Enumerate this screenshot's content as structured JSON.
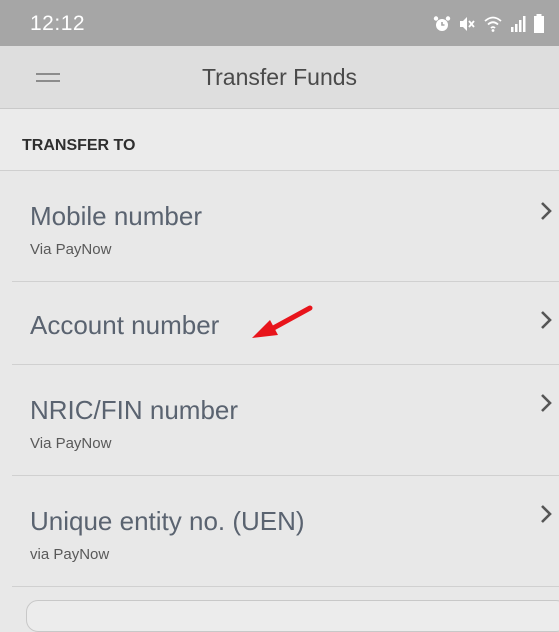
{
  "status_bar": {
    "time": "12:12",
    "icons": [
      "alarm-icon",
      "mute-icon",
      "wifi-icon",
      "signal-icon",
      "battery-icon"
    ]
  },
  "header": {
    "title": "Transfer Funds",
    "menu_icon": "hamburger-menu-icon"
  },
  "section": {
    "label": "TRANSFER TO"
  },
  "transfer_options": [
    {
      "title": "Mobile number",
      "subtitle": "Via PayNow"
    },
    {
      "title": "Account number",
      "subtitle": ""
    },
    {
      "title": "NRIC/FIN number",
      "subtitle": "Via PayNow"
    },
    {
      "title": "Unique entity no. (UEN)",
      "subtitle": "via PayNow"
    }
  ],
  "annotation": {
    "arrow_color": "#e8141b"
  },
  "colors": {
    "status_bar": "#a6a6a6",
    "app_bar": "#dedede",
    "background": "#e8e8e8",
    "row_title": "#5a6370"
  }
}
